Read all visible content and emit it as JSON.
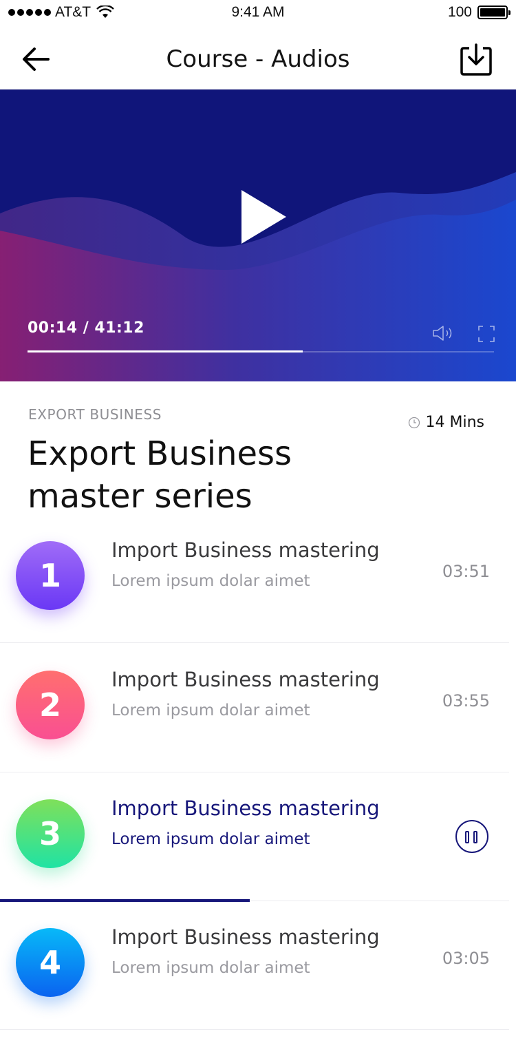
{
  "status_bar": {
    "carrier": "AT&T",
    "time": "9:41 AM",
    "battery": "100"
  },
  "header": {
    "title": "Course - Audios"
  },
  "player": {
    "time_readout": "00:14 / 41:12",
    "progress_fraction": 0.59
  },
  "course": {
    "category": "EXPORT BUSINESS",
    "duration": "14 Mins",
    "title": "Export Business master series"
  },
  "tracks": [
    {
      "number": "1",
      "title": "Import Business mastering",
      "subtitle": "Lorem ipsum dolar aimet",
      "duration": "03:51",
      "color": "#7b4cf6"
    },
    {
      "number": "2",
      "title": "Import Business mastering",
      "subtitle": "Lorem ipsum dolar aimet",
      "duration": "03:55",
      "color": "#fb5b85"
    },
    {
      "number": "3",
      "title": "Import Business mastering",
      "subtitle": "Lorem ipsum dolar aimet",
      "state": "playing",
      "progress_fraction": 0.49,
      "color": "#3de09a"
    },
    {
      "number": "4",
      "title": "Import Business mastering",
      "subtitle": "Lorem ipsum dolar aimet",
      "duration": "03:05",
      "color": "#0a8ef4"
    }
  ],
  "colors": {
    "accent": "#17177a",
    "player_bg": "#10157a"
  },
  "icons": [
    "back-arrow-icon",
    "download-icon",
    "play-icon",
    "volume-icon",
    "fullscreen-icon",
    "clock-icon",
    "pause-icon",
    "wifi-icon",
    "battery-icon"
  ]
}
